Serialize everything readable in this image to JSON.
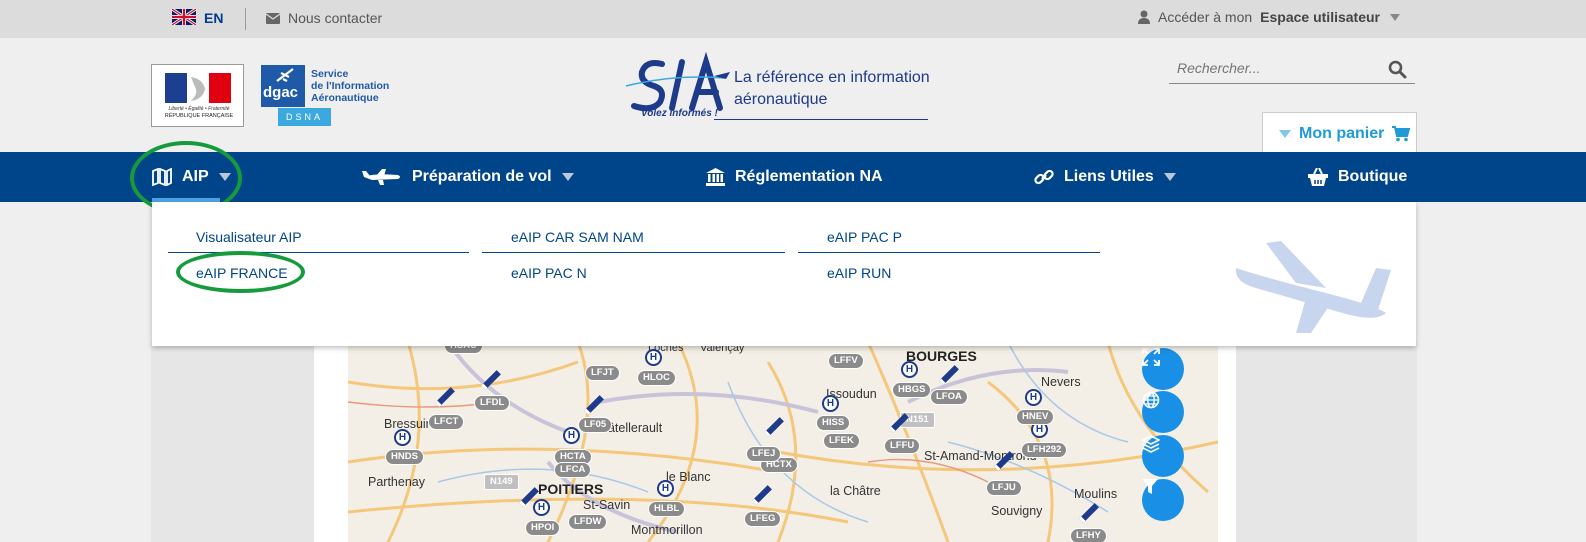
{
  "topbar": {
    "lang": "EN",
    "contact": "Nous contacter",
    "user_prefix": "Accéder à mon",
    "user_bold": "Espace utilisateur"
  },
  "header": {
    "marianne_motto": "Liberté • Égalité • Fraternité",
    "marianne_name": "RÉPUBLIQUE FRANÇAISE",
    "dgac_word": "dgac",
    "dsna_word": "DSNA",
    "dgac_text": "Service\nde l'Information\nAéronautique",
    "sia_title": "La référence en information aéronautique",
    "sia_tagline": "Volez informés !",
    "search_placeholder": "Rechercher...",
    "cart_label": "Mon panier"
  },
  "nav": {
    "aip": "AIP",
    "preparation": "Préparation de vol",
    "reglementation": "Réglementation NA",
    "liens": "Liens Utiles",
    "boutique": "Boutique"
  },
  "dropdown": {
    "items": [
      "Visualisateur AIP",
      "eAIP FRANCE",
      "eAIP CAR SAM NAM",
      "eAIP PAC N",
      "eAIP PAC P",
      "eAIP RUN"
    ]
  },
  "map": {
    "labels": [
      "BOURGES",
      "POITIERS",
      "Nevers",
      "Moulins",
      "Parthenay",
      "Bressuire",
      "Issoudun",
      "Châtellerault",
      "le Blanc",
      "la Châtre",
      "St-Amand-Montrond",
      "Souvigny",
      "Montmorillon",
      "St-Savin",
      "Valençay",
      "Loches",
      "N149",
      "N151"
    ],
    "tags": [
      "LFDL",
      "LFCT",
      "LFJT",
      "HLOC",
      "LF05",
      "HCTA",
      "LFCA",
      "HNDS",
      "LFFV",
      "HBGS",
      "LFOA",
      "HISS",
      "LFEK",
      "LFFU",
      "HCTX",
      "LFEJ",
      "LFEG",
      "HLBL",
      "HPOI",
      "LFDW",
      "LFJU",
      "HNEV",
      "LFH292",
      "HSAU",
      "LFHY"
    ]
  },
  "colors": {
    "nav_blue": "#00448a",
    "highlight_green": "#159a3c",
    "accent_blue": "#1e9bd7"
  }
}
